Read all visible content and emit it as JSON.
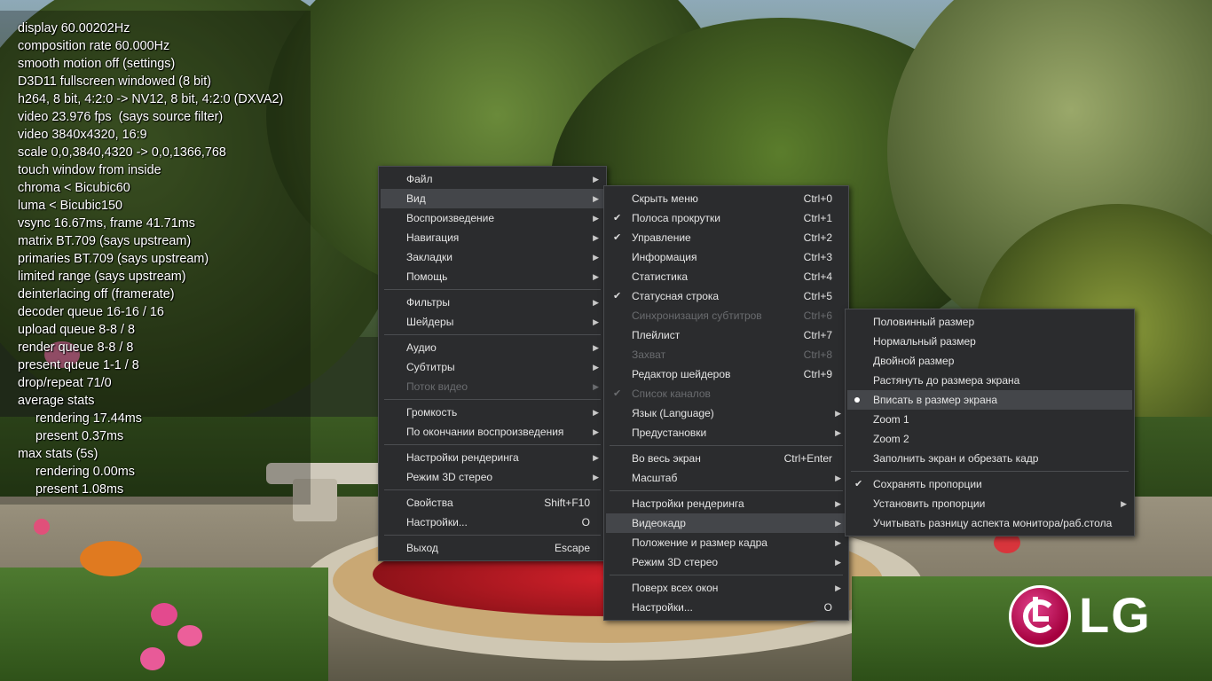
{
  "osd": {
    "lines": [
      {
        "text": "display 60.00202Hz",
        "indent": false
      },
      {
        "text": "composition rate 60.000Hz",
        "indent": false
      },
      {
        "text": "smooth motion off (settings)",
        "indent": false
      },
      {
        "text": "D3D11 fullscreen windowed (8 bit)",
        "indent": false
      },
      {
        "text": "h264, 8 bit, 4:2:0 -> NV12, 8 bit, 4:2:0 (DXVA2)",
        "indent": false
      },
      {
        "text": "video 23.976 fps  (says source filter)",
        "indent": false
      },
      {
        "text": "video 3840x4320, 16:9",
        "indent": false
      },
      {
        "text": "scale 0,0,3840,4320 -> 0,0,1366,768",
        "indent": false
      },
      {
        "text": "touch window from inside",
        "indent": false
      },
      {
        "text": "chroma < Bicubic60",
        "indent": false
      },
      {
        "text": "luma < Bicubic150",
        "indent": false
      },
      {
        "text": "vsync 16.67ms, frame 41.71ms",
        "indent": false
      },
      {
        "text": "matrix BT.709 (says upstream)",
        "indent": false
      },
      {
        "text": "primaries BT.709 (says upstream)",
        "indent": false
      },
      {
        "text": "limited range (says upstream)",
        "indent": false
      },
      {
        "text": "deinterlacing off (framerate)",
        "indent": false
      },
      {
        "text": "decoder queue 16-16 / 16",
        "indent": false
      },
      {
        "text": "upload queue 8-8 / 8",
        "indent": false
      },
      {
        "text": "render queue 8-8 / 8",
        "indent": false
      },
      {
        "text": "present queue 1-1 / 8",
        "indent": false
      },
      {
        "text": "drop/repeat 71/0",
        "indent": false
      },
      {
        "text": "average stats",
        "indent": false
      },
      {
        "text": "rendering 17.44ms",
        "indent": true
      },
      {
        "text": "present 0.37ms",
        "indent": true
      },
      {
        "text": "max stats (5s)",
        "indent": false
      },
      {
        "text": "rendering 0.00ms",
        "indent": true
      },
      {
        "text": "present 1.08ms",
        "indent": true
      }
    ]
  },
  "main_menu": [
    {
      "label": "Файл",
      "submenu": true
    },
    {
      "label": "Вид",
      "submenu": true,
      "highlighted": true
    },
    {
      "label": "Воспроизведение",
      "submenu": true
    },
    {
      "label": "Навигация",
      "submenu": true
    },
    {
      "label": "Закладки",
      "submenu": true
    },
    {
      "label": "Помощь",
      "submenu": true
    },
    {
      "separator": true
    },
    {
      "label": "Фильтры",
      "submenu": true
    },
    {
      "label": "Шейдеры",
      "submenu": true
    },
    {
      "separator": true
    },
    {
      "label": "Аудио",
      "submenu": true
    },
    {
      "label": "Субтитры",
      "submenu": true
    },
    {
      "label": "Поток видео",
      "submenu": true,
      "disabled": true
    },
    {
      "separator": true
    },
    {
      "label": "Громкость",
      "submenu": true
    },
    {
      "label": "По окончании воспроизведения",
      "submenu": true
    },
    {
      "separator": true
    },
    {
      "label": "Настройки рендеринга",
      "submenu": true
    },
    {
      "label": "Режим 3D стерео",
      "submenu": true
    },
    {
      "separator": true
    },
    {
      "label": "Свойства",
      "shortcut": "Shift+F10"
    },
    {
      "label": "Настройки...",
      "shortcut": "O"
    },
    {
      "separator": true
    },
    {
      "label": "Выход",
      "shortcut": "Escape"
    }
  ],
  "view_menu": [
    {
      "label": "Скрыть меню",
      "shortcut": "Ctrl+0"
    },
    {
      "label": "Полоса прокрутки",
      "shortcut": "Ctrl+1",
      "checked": true
    },
    {
      "label": "Управление",
      "shortcut": "Ctrl+2",
      "checked": true
    },
    {
      "label": "Информация",
      "shortcut": "Ctrl+3"
    },
    {
      "label": "Статистика",
      "shortcut": "Ctrl+4"
    },
    {
      "label": "Статусная строка",
      "shortcut": "Ctrl+5",
      "checked": true
    },
    {
      "label": "Синхронизация субтитров",
      "shortcut": "Ctrl+6",
      "disabled": true
    },
    {
      "label": "Плейлист",
      "shortcut": "Ctrl+7"
    },
    {
      "label": "Захват",
      "shortcut": "Ctrl+8",
      "disabled": true
    },
    {
      "label": "Редактор шейдеров",
      "shortcut": "Ctrl+9"
    },
    {
      "label": "Список каналов",
      "disabled": true,
      "checked": true
    },
    {
      "label": "Язык (Language)",
      "submenu": true
    },
    {
      "label": "Предустановки",
      "submenu": true
    },
    {
      "separator": true
    },
    {
      "label": "Во весь экран",
      "shortcut": "Ctrl+Enter"
    },
    {
      "label": "Масштаб",
      "submenu": true
    },
    {
      "separator": true
    },
    {
      "label": "Настройки рендеринга",
      "submenu": true
    },
    {
      "label": "Видеокадр",
      "submenu": true,
      "highlighted": true
    },
    {
      "label": "Положение и размер кадра",
      "submenu": true
    },
    {
      "label": "Режим 3D стерео",
      "submenu": true
    },
    {
      "separator": true
    },
    {
      "label": "Поверх всех окон",
      "submenu": true
    },
    {
      "label": "Настройки...",
      "shortcut": "O"
    }
  ],
  "frame_menu": [
    {
      "label": "Половинный размер"
    },
    {
      "label": "Нормальный размер"
    },
    {
      "label": "Двойной размер"
    },
    {
      "label": "Растянуть до размера экрана"
    },
    {
      "label": "Вписать в размер экрана",
      "radio": true,
      "highlighted": true
    },
    {
      "label": "Zoom 1"
    },
    {
      "label": "Zoom 2"
    },
    {
      "label": "Заполнить экран и обрезать кадр"
    },
    {
      "separator": true
    },
    {
      "label": "Сохранять пропорции",
      "checked": true
    },
    {
      "label": "Установить пропорции",
      "submenu": true
    },
    {
      "label": "Учитывать разницу аспекта монитора/раб.стола"
    }
  ],
  "watermark": {
    "text": "LG",
    "logo_icon": "lg-logo-icon"
  },
  "colors": {
    "menu_bg": "#2b2c2e",
    "menu_highlight": "#44464a",
    "menu_text": "#e4e4e4",
    "menu_disabled": "#6a6c6f",
    "lg_magenta": "#a5003e"
  }
}
